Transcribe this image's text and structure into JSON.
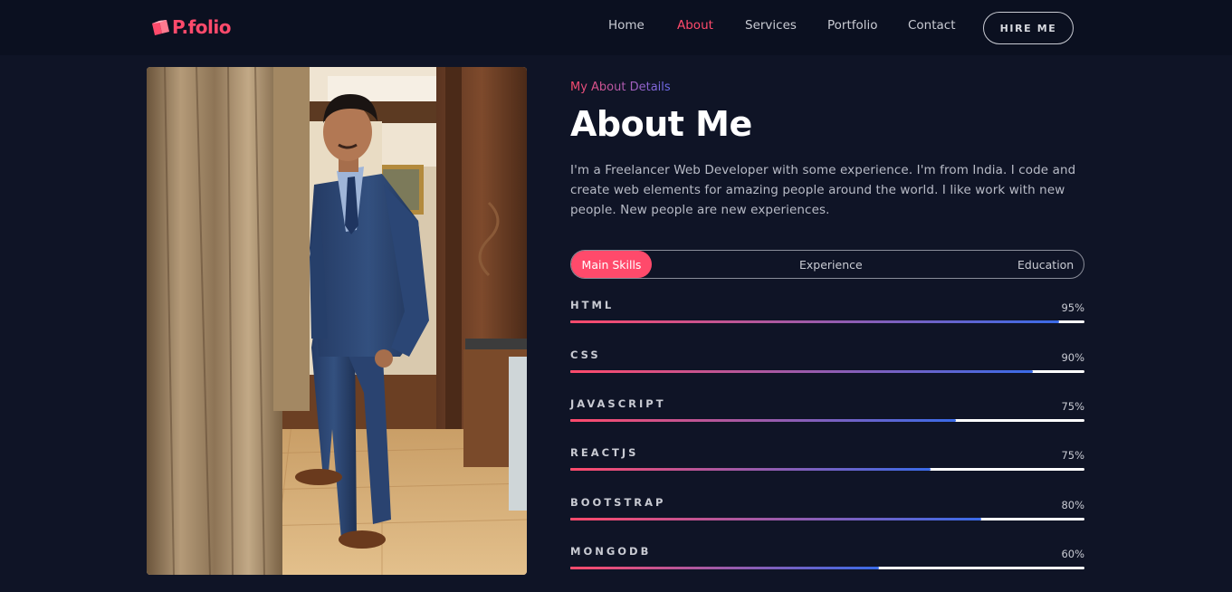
{
  "brand": {
    "name": "P.folio",
    "accent": "#ff4a6b"
  },
  "nav": {
    "items": [
      "Home",
      "About",
      "Services",
      "Portfolio",
      "Contact"
    ],
    "active": "About",
    "hire_label": "HIRE ME"
  },
  "about": {
    "eyebrow": "My About Details",
    "title": "About Me",
    "description": "I'm a Freelancer Web Developer with some experience. I'm from India. I code and create web elements for amazing people around the world. I like work with new people. New people are new experiences."
  },
  "tabs": {
    "items": [
      "Main Skills",
      "Experience",
      "Education"
    ],
    "active": "Main Skills"
  },
  "skills": [
    {
      "name": "HTML",
      "percent_label": "95%",
      "level": 0.95
    },
    {
      "name": "CSS",
      "percent_label": "90%",
      "level": 0.9
    },
    {
      "name": "JAVASCRIPT",
      "percent_label": "75%",
      "level": 0.75
    },
    {
      "name": "REACTJS",
      "percent_label": "75%",
      "level": 0.7
    },
    {
      "name": "BOOTSTRAP",
      "percent_label": "80%",
      "level": 0.8
    },
    {
      "name": "MONGODB",
      "percent_label": "60%",
      "level": 0.6
    }
  ],
  "colors": {
    "background": "#0f1426",
    "header_bg": "#0b1020",
    "accent": "#ff4a6b",
    "bar_gradient_end": "#3a6be8"
  }
}
